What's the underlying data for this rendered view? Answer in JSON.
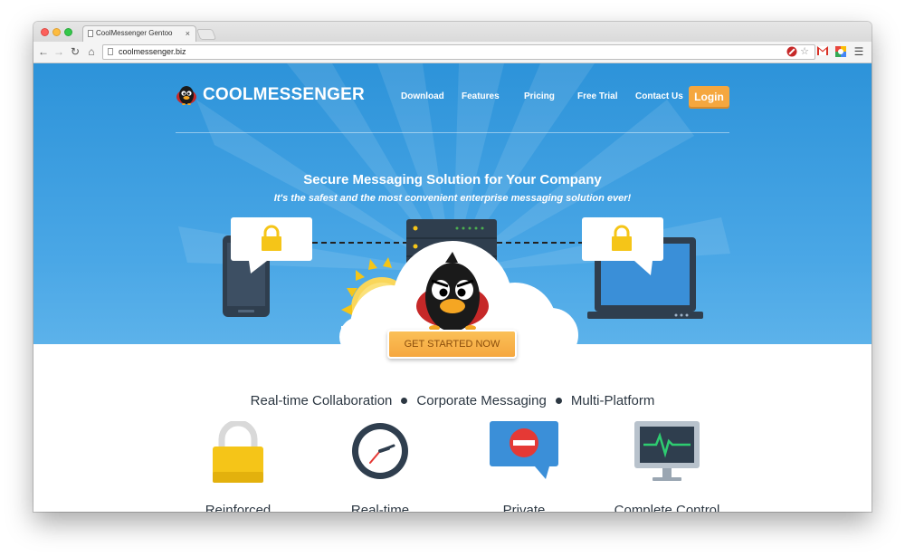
{
  "browser": {
    "tab_title": "CoolMessenger Gentoo",
    "tab_close": "×",
    "url": "coolmessenger.biz",
    "icons": [
      "back-icon",
      "forward-icon",
      "reload-icon",
      "home-icon",
      "page-icon",
      "stop-icon",
      "star-icon",
      "gmail-icon",
      "chrome-icon",
      "menu-icon"
    ]
  },
  "site": {
    "logo_text": "COOLMESSENGER",
    "nav": [
      {
        "label": "Download"
      },
      {
        "label": "Features"
      },
      {
        "label": "Pricing"
      },
      {
        "label": "Free Trial"
      },
      {
        "label": "Contact Us"
      }
    ],
    "login_label": "Login"
  },
  "hero": {
    "headline": "Secure Messaging Solution for Your Company",
    "subheadline": "It's the safest and the most convenient enterprise messaging solution ever!",
    "cta_label": "GET STARTED NOW"
  },
  "features": {
    "items": [
      "Real-time Collaboration",
      "Corporate Messaging",
      "Multi-Platform"
    ],
    "cards": [
      {
        "label": "Reinforced",
        "icon": "padlock-icon"
      },
      {
        "label": "Real-time",
        "icon": "clock-icon"
      },
      {
        "label": "Private",
        "icon": "private-chat-icon"
      },
      {
        "label": "Complete Control",
        "icon": "monitor-icon"
      }
    ]
  },
  "colors": {
    "hero_blue": "#3b9fe2",
    "accent_orange": "#f5a73f",
    "dark_text": "#2c3742",
    "lock_yellow": "#f5c518"
  }
}
